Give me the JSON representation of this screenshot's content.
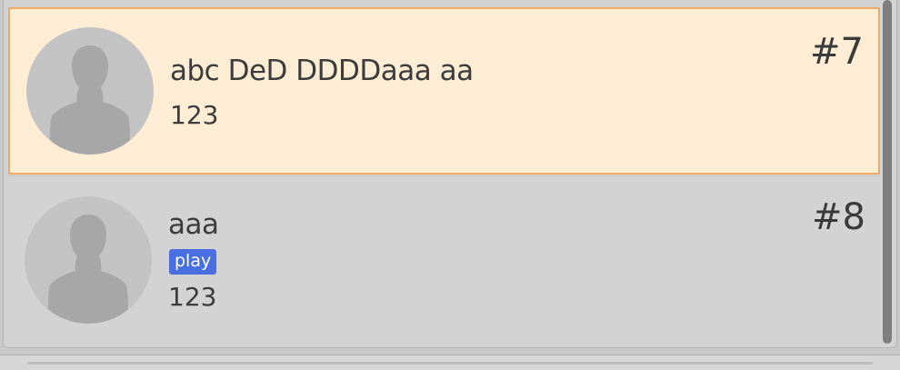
{
  "list": {
    "items": [
      {
        "name": "abc DeD DDDDaaa aa",
        "subtitle": "123",
        "rank": "#7",
        "badge": null,
        "selected": true,
        "avatar_icon": "person-silhouette-icon"
      },
      {
        "name": "aaa",
        "subtitle": "123",
        "rank": "#8",
        "badge": "play",
        "selected": false,
        "avatar_icon": "person-silhouette-icon"
      }
    ]
  },
  "colors": {
    "selected_background": "#ffeed5",
    "selected_border": "#f2aa63",
    "list_background": "#d3d3d3",
    "badge_background": "#4a6fe0",
    "text": "#3c3c3c",
    "scrollbar_thumb": "#7e7e7e"
  }
}
